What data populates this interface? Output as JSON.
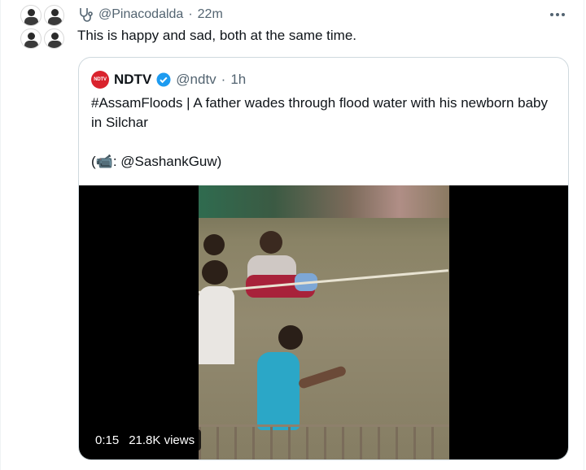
{
  "tweet": {
    "handle": "@Pinacodalda",
    "separator": "·",
    "time": "22m",
    "text": "This is happy and sad, both at the same time.",
    "avatar_icon": "collage-avatar",
    "handle_icon": "stethoscope-icon"
  },
  "quote": {
    "logo_text": "NDTV",
    "name": "NDTV",
    "verified_color": "#1d9bf0",
    "handle": "@ndtv",
    "separator": "·",
    "time": "1h",
    "text_line": "#AssamFloods | A father wades through flood water with his newborn baby in Silchar",
    "credit": "(📹: @SashankGuw)"
  },
  "video": {
    "timestamp": "0:15",
    "views": "21.8K views"
  },
  "colors": {
    "secondary_text": "#536471",
    "border": "#cfd9de",
    "ndtv_red": "#d9232d"
  }
}
